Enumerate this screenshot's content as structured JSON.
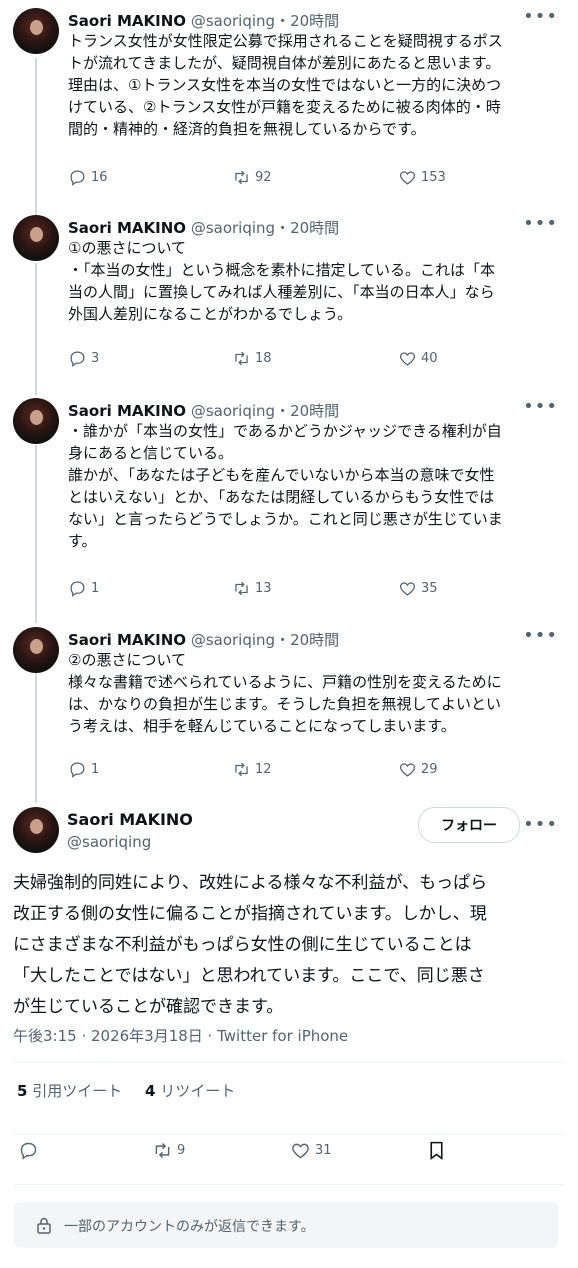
{
  "thread": [
    {
      "name": "Saori MAKINO",
      "handle": "@saoriqing",
      "time": "・20時間",
      "text": "トランス女性が女性限定公募で採用されることを疑問視するポス\nトが流れてきましたが、疑問視自体が差別にあたると思います。\n理由は、①トランス女性を本当の女性ではないと一方的に決めつ\nけている、②トランス女性が戸籍を変えるために被る肉体的・時\n間的・精神的・経済的負担を無視しているからです。",
      "replies": "16",
      "retweets": "92",
      "likes": "153"
    },
    {
      "name": "Saori MAKINO",
      "handle": "@saoriqing",
      "time": "・20時間",
      "text": "①の悪さについて\n・「本当の女性」という概念を素朴に措定している。これは「本\n当の人間」に置換してみれば人種差別に、「本当の日本人」なら\n外国人差別になることがわかるでしょう。",
      "replies": "3",
      "retweets": "18",
      "likes": "40"
    },
    {
      "name": "Saori MAKINO",
      "handle": "@saoriqing",
      "time": "・20時間",
      "text": "・誰かが「本当の女性」であるかどうかジャッジできる権利が自\n身にあると信じている。\n誰かが、「あなたは子どもを産んでいないから本当の意味で女性\nとはいえない」とか、「あなたは閉経しているからもう女性では\nない」と言ったらどうでしょうか。これと同じ悪さが生じていま\nす。",
      "replies": "1",
      "retweets": "13",
      "likes": "35"
    },
    {
      "name": "Saori MAKINO",
      "handle": "@saoriqing",
      "time": "・20時間",
      "text": "②の悪さについて\n様々な書籍で述べられているように、戸籍の性別を変えるために\nは、かなりの負担が生じます。そうした負担を無視してよいとい\nう考えは、相手を軽んじていることになってしまいます。",
      "replies": "1",
      "retweets": "12",
      "likes": "29"
    }
  ],
  "main": {
    "name": "Saori MAKINO",
    "handle": "@saoriqing",
    "follow_label": "フォロー",
    "text": "夫婦強制的同姓により、改姓による様々な不利益が、もっぱら\n改正する側の女性に偏ることが指摘されています。しかし、現\nにさまざまな不利益がもっぱら女性の側に生じていることは\n「大したことではない」と思われています。ここで、同じ悪さ\nが生じていることが確認できます。",
    "meta": "午後3:15 · 2026年3月18日 · Twitter for iPhone",
    "quote_count": "5",
    "quote_label": "引用ツイート",
    "retweet_count": "4",
    "retweet_label": "リツイート",
    "retweets": "9",
    "likes": "31",
    "reply_restriction": "一部のアカウントのみが返信できます。"
  },
  "more_glyph": "•••",
  "colors": {
    "text": "#0f1419",
    "secondary": "#536471",
    "border": "#cfd9de"
  }
}
